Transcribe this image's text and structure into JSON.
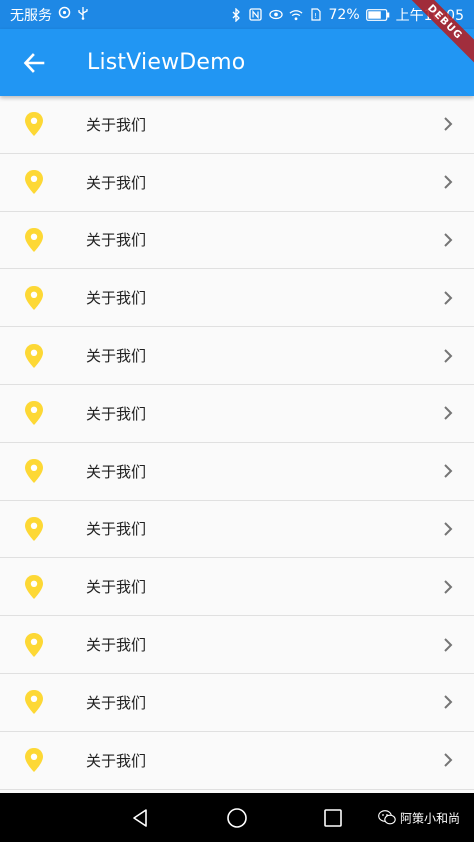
{
  "status_bar": {
    "carrier": "无服务",
    "battery": "72%",
    "time": "上午10:05"
  },
  "app_bar": {
    "title": "ListViewDemo"
  },
  "debug_banner": {
    "label": "DEBUG"
  },
  "list": {
    "items": [
      {
        "title": "关于我们",
        "icon": "location-pin-icon",
        "trailing": "chevron-right-icon"
      },
      {
        "title": "关于我们",
        "icon": "location-pin-icon",
        "trailing": "chevron-right-icon"
      },
      {
        "title": "关于我们",
        "icon": "location-pin-icon",
        "trailing": "chevron-right-icon"
      },
      {
        "title": "关于我们",
        "icon": "location-pin-icon",
        "trailing": "chevron-right-icon"
      },
      {
        "title": "关于我们",
        "icon": "location-pin-icon",
        "trailing": "chevron-right-icon"
      },
      {
        "title": "关于我们",
        "icon": "location-pin-icon",
        "trailing": "chevron-right-icon"
      },
      {
        "title": "关于我们",
        "icon": "location-pin-icon",
        "trailing": "chevron-right-icon"
      },
      {
        "title": "关于我们",
        "icon": "location-pin-icon",
        "trailing": "chevron-right-icon"
      },
      {
        "title": "关于我们",
        "icon": "location-pin-icon",
        "trailing": "chevron-right-icon"
      },
      {
        "title": "关于我们",
        "icon": "location-pin-icon",
        "trailing": "chevron-right-icon"
      },
      {
        "title": "关于我们",
        "icon": "location-pin-icon",
        "trailing": "chevron-right-icon"
      },
      {
        "title": "关于我们",
        "icon": "location-pin-icon",
        "trailing": "chevron-right-icon"
      }
    ]
  },
  "watermark": {
    "text": "阿策小和尚"
  },
  "colors": {
    "status_bar": "#1e88e5",
    "app_bar": "#2196f3",
    "pin": "#fdd835",
    "chevron": "#757575",
    "divider": "#e0e0e0",
    "background": "#fafafa"
  }
}
